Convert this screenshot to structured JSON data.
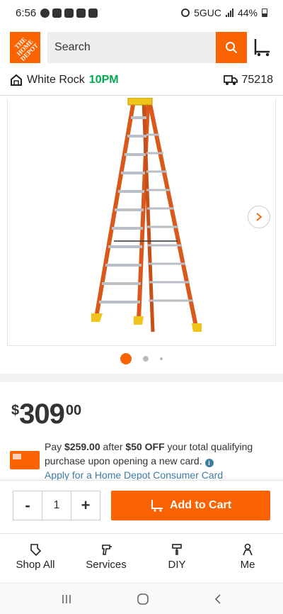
{
  "status_bar": {
    "time": "6:56",
    "network": "5GUC",
    "battery": "44%"
  },
  "header": {
    "logo_text": "THE HOME DEPOT",
    "search_placeholder": "Search"
  },
  "store": {
    "name": "White Rock",
    "closing_time": "10PM",
    "zip": "75218"
  },
  "gallery": {
    "images": 3,
    "active_index": 0
  },
  "price": {
    "currency": "$",
    "dollars": "309",
    "cents": "00"
  },
  "promo": {
    "prefix": "Pay ",
    "promo_price": "$259.00",
    "middle": " after ",
    "discount": "$50 OFF",
    "suffix": " your total qualifying purchase upon opening a new card.",
    "link": "Apply for a Home Depot Consumer Card"
  },
  "cart": {
    "minus": "-",
    "quantity": "1",
    "plus": "+",
    "add_label": "Add to Cart"
  },
  "bottom_nav": [
    {
      "label": "Shop All",
      "icon": "tag-icon"
    },
    {
      "label": "Services",
      "icon": "drill-icon"
    },
    {
      "label": "DIY",
      "icon": "paint-roller-icon"
    },
    {
      "label": "Me",
      "icon": "person-icon"
    }
  ],
  "colors": {
    "brand": "#f96302",
    "store_time": "#00a950",
    "link": "#3e7ca6"
  }
}
